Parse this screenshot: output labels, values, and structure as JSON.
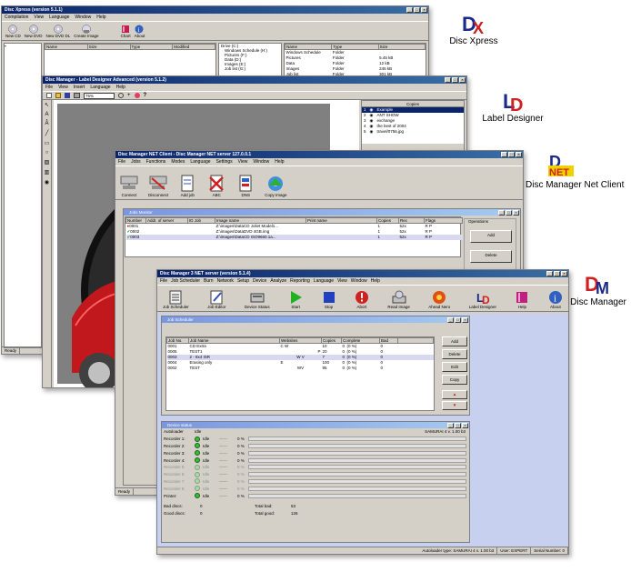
{
  "brands": {
    "disc_xpress": "Disc Xpress",
    "label_designer": "Label Designer",
    "net_client": "Disc Manager Net Client",
    "disc_manager": "Disc Manager"
  },
  "dx_window": {
    "title": "Disc Xpress   (version 5.1.1)",
    "menu": [
      "Compilation",
      "View",
      "Language",
      "Window",
      "Help"
    ],
    "toolbar": [
      "New CD",
      "New DVD",
      "New DVD DL",
      "Create Image",
      "Chart",
      "About"
    ],
    "file_cols": [
      "Name",
      "Size",
      "Type",
      "Modified"
    ],
    "tree_root": "Drive (C:)",
    "tree": [
      "Windows Schedule (H:)",
      "Pictures (F:)",
      "Data (D:)",
      "Images (E:)",
      "Job list (G:)"
    ],
    "right_cols": [
      "Name",
      "Type",
      "Size"
    ],
    "right_rows": [
      {
        "name": "Windows Schedule",
        "type": "Folder",
        "size": ""
      },
      {
        "name": "Pictures",
        "type": "Folder",
        "size": "5.45 kB"
      },
      {
        "name": "Data",
        "type": "Folder",
        "size": "12 kB"
      },
      {
        "name": "Images",
        "type": "Folder",
        "size": "245 kB"
      },
      {
        "name": "Job list",
        "type": "Folder",
        "size": "301 kB"
      }
    ],
    "status": "Ready"
  },
  "ld_window": {
    "title": "Disc Manager - Label Designer Advanced   (version 5.1.2)",
    "menu": [
      "File",
      "View",
      "Insert",
      "Language",
      "Help"
    ],
    "zoom": "75%",
    "copies_header": "Copies",
    "copies": [
      {
        "n": "1",
        "name": "Example"
      },
      {
        "n": "2",
        "name": "ANT SHOW"
      },
      {
        "n": "3",
        "name": "exchange"
      },
      {
        "n": "4",
        "name": "the best of 2004"
      },
      {
        "n": "5",
        "name": "travel/0756.jpg"
      }
    ],
    "left_list": [
      "0001",
      "0002",
      "0003",
      "0004",
      "0005",
      "0006",
      "0007",
      "0008"
    ],
    "left_labels": [
      "Autoloader",
      "Recorder",
      "Recorder",
      "Recorder",
      "Recorder",
      "Printer"
    ]
  },
  "net_window": {
    "title": "Disc Manager NET Client - Disc Manager NET server 127.0.0.1",
    "menu": [
      "File",
      "Jobs",
      "Functions",
      "Modes",
      "Language",
      "Settings",
      "View",
      "Window",
      "Help"
    ],
    "toolbar": [
      "Connect",
      "Disconnect",
      "Add job",
      "ABC",
      "DNS",
      "Copy Image"
    ],
    "panel_title": "Jobs Monitor",
    "cols": [
      "Number",
      "Addr. of server",
      "ID Job",
      "Image name",
      "Print name",
      "Copies",
      "Rec",
      "Flags"
    ],
    "rows": [
      {
        "num": "0001",
        "image": "Z:\\images\\DataCD Joliet Model1...",
        "copies": "1",
        "rec": "52x",
        "flags": "R P"
      },
      {
        "num": "0002",
        "image": "Z:\\images\\DataDVD 4GB.img",
        "copies": "1",
        "rec": "52x",
        "flags": "R P"
      },
      {
        "num": "0003",
        "image": "Z:\\images\\DataCD ISO9660.1a...",
        "copies": "1",
        "rec": "52x",
        "flags": "R P"
      }
    ],
    "operations": "Operations",
    "add": "Add",
    "delete": "Delete",
    "status": "Ready"
  },
  "dm_window": {
    "title": "Disc Manager 3 NET server   (version 5.1.4)",
    "menu": [
      "File",
      "Job Scheduler",
      "Burn",
      "Network",
      "Setup",
      "Device",
      "Analyze",
      "Reporting",
      "Language",
      "View",
      "Window",
      "Help"
    ],
    "toolbar": [
      "Job Scheduler",
      "Job Editor",
      "Device Status",
      "Start",
      "Stop",
      "Abort",
      "Read Image",
      "Ahead Nero",
      "Label Designer",
      "Help",
      "About"
    ],
    "scheduler_title": "Job Scheduler",
    "cols": [
      "Job No.",
      "Job Name",
      "Websites",
      "Copies",
      "Complete",
      "Bad"
    ],
    "jobs": [
      {
        "no": "0001",
        "name": "CD Extra",
        "web": "C W",
        "copies": "10",
        "complete": "0",
        "pct": "(0 %)",
        "bad": "0"
      },
      {
        "no": "0005",
        "name": "TEST1",
        "web": "P",
        "copies": "20",
        "complete": "0",
        "pct": "(0 %)",
        "bad": "0"
      },
      {
        "no": "0003",
        "name": "2 - 8x4 ISR",
        "web": "W  V",
        "copies": "7",
        "complete": "0",
        "pct": "(0 %)",
        "bad": "0"
      },
      {
        "no": "0004",
        "name": "Erasing only",
        "web": "E",
        "copies": "100",
        "complete": "0",
        "pct": "(0 %)",
        "bad": "0"
      },
      {
        "no": "0002",
        "name": "TEST",
        "web": "WV",
        "copies": "95",
        "complete": "0",
        "pct": "(0 %)",
        "bad": "0"
      }
    ],
    "buttons": [
      "Add",
      "Delete",
      "Edit",
      "Copy"
    ],
    "device_title": "Device status",
    "autoloader": {
      "label": "Autoloader",
      "state": "Idle",
      "model": "SAMURAI 4  v. 1.00 b3"
    },
    "devices": [
      {
        "label": "Recorder 1:",
        "state": "Idle",
        "dash": "------",
        "pct": "0 %"
      },
      {
        "label": "Recorder 2:",
        "state": "Idle",
        "dash": "------",
        "pct": "0 %"
      },
      {
        "label": "Recorder 3:",
        "state": "Idle",
        "dash": "------",
        "pct": "0 %"
      },
      {
        "label": "Recorder 4:",
        "state": "Idle",
        "dash": "------",
        "pct": "0 %"
      },
      {
        "label": "Recorder 5:",
        "state": "Idle",
        "dash": "------",
        "pct": "0 %"
      },
      {
        "label": "Recorder 6:",
        "state": "Idle",
        "dash": "------",
        "pct": "0 %"
      },
      {
        "label": "Recorder 7:",
        "state": "Idle",
        "dash": "------",
        "pct": "0 %"
      },
      {
        "label": "Recorder 8:",
        "state": "Idle",
        "dash": "------",
        "pct": "0 %"
      },
      {
        "label": "Printer:",
        "state": "Idle",
        "dash": "------",
        "pct": "0 %"
      }
    ],
    "totals": {
      "bad_label": "Bad discs:",
      "bad": "0",
      "good_label": "Good discs:",
      "good": "0",
      "total_bad_label": "Total bad:",
      "total_bad": "53",
      "total_good_label": "Total good:",
      "total_good": "126"
    },
    "status": [
      "Autoloader type: SAMURAI 4  v. 1.00 b3",
      "User: EXPERT",
      "Serial Number: 0"
    ]
  }
}
